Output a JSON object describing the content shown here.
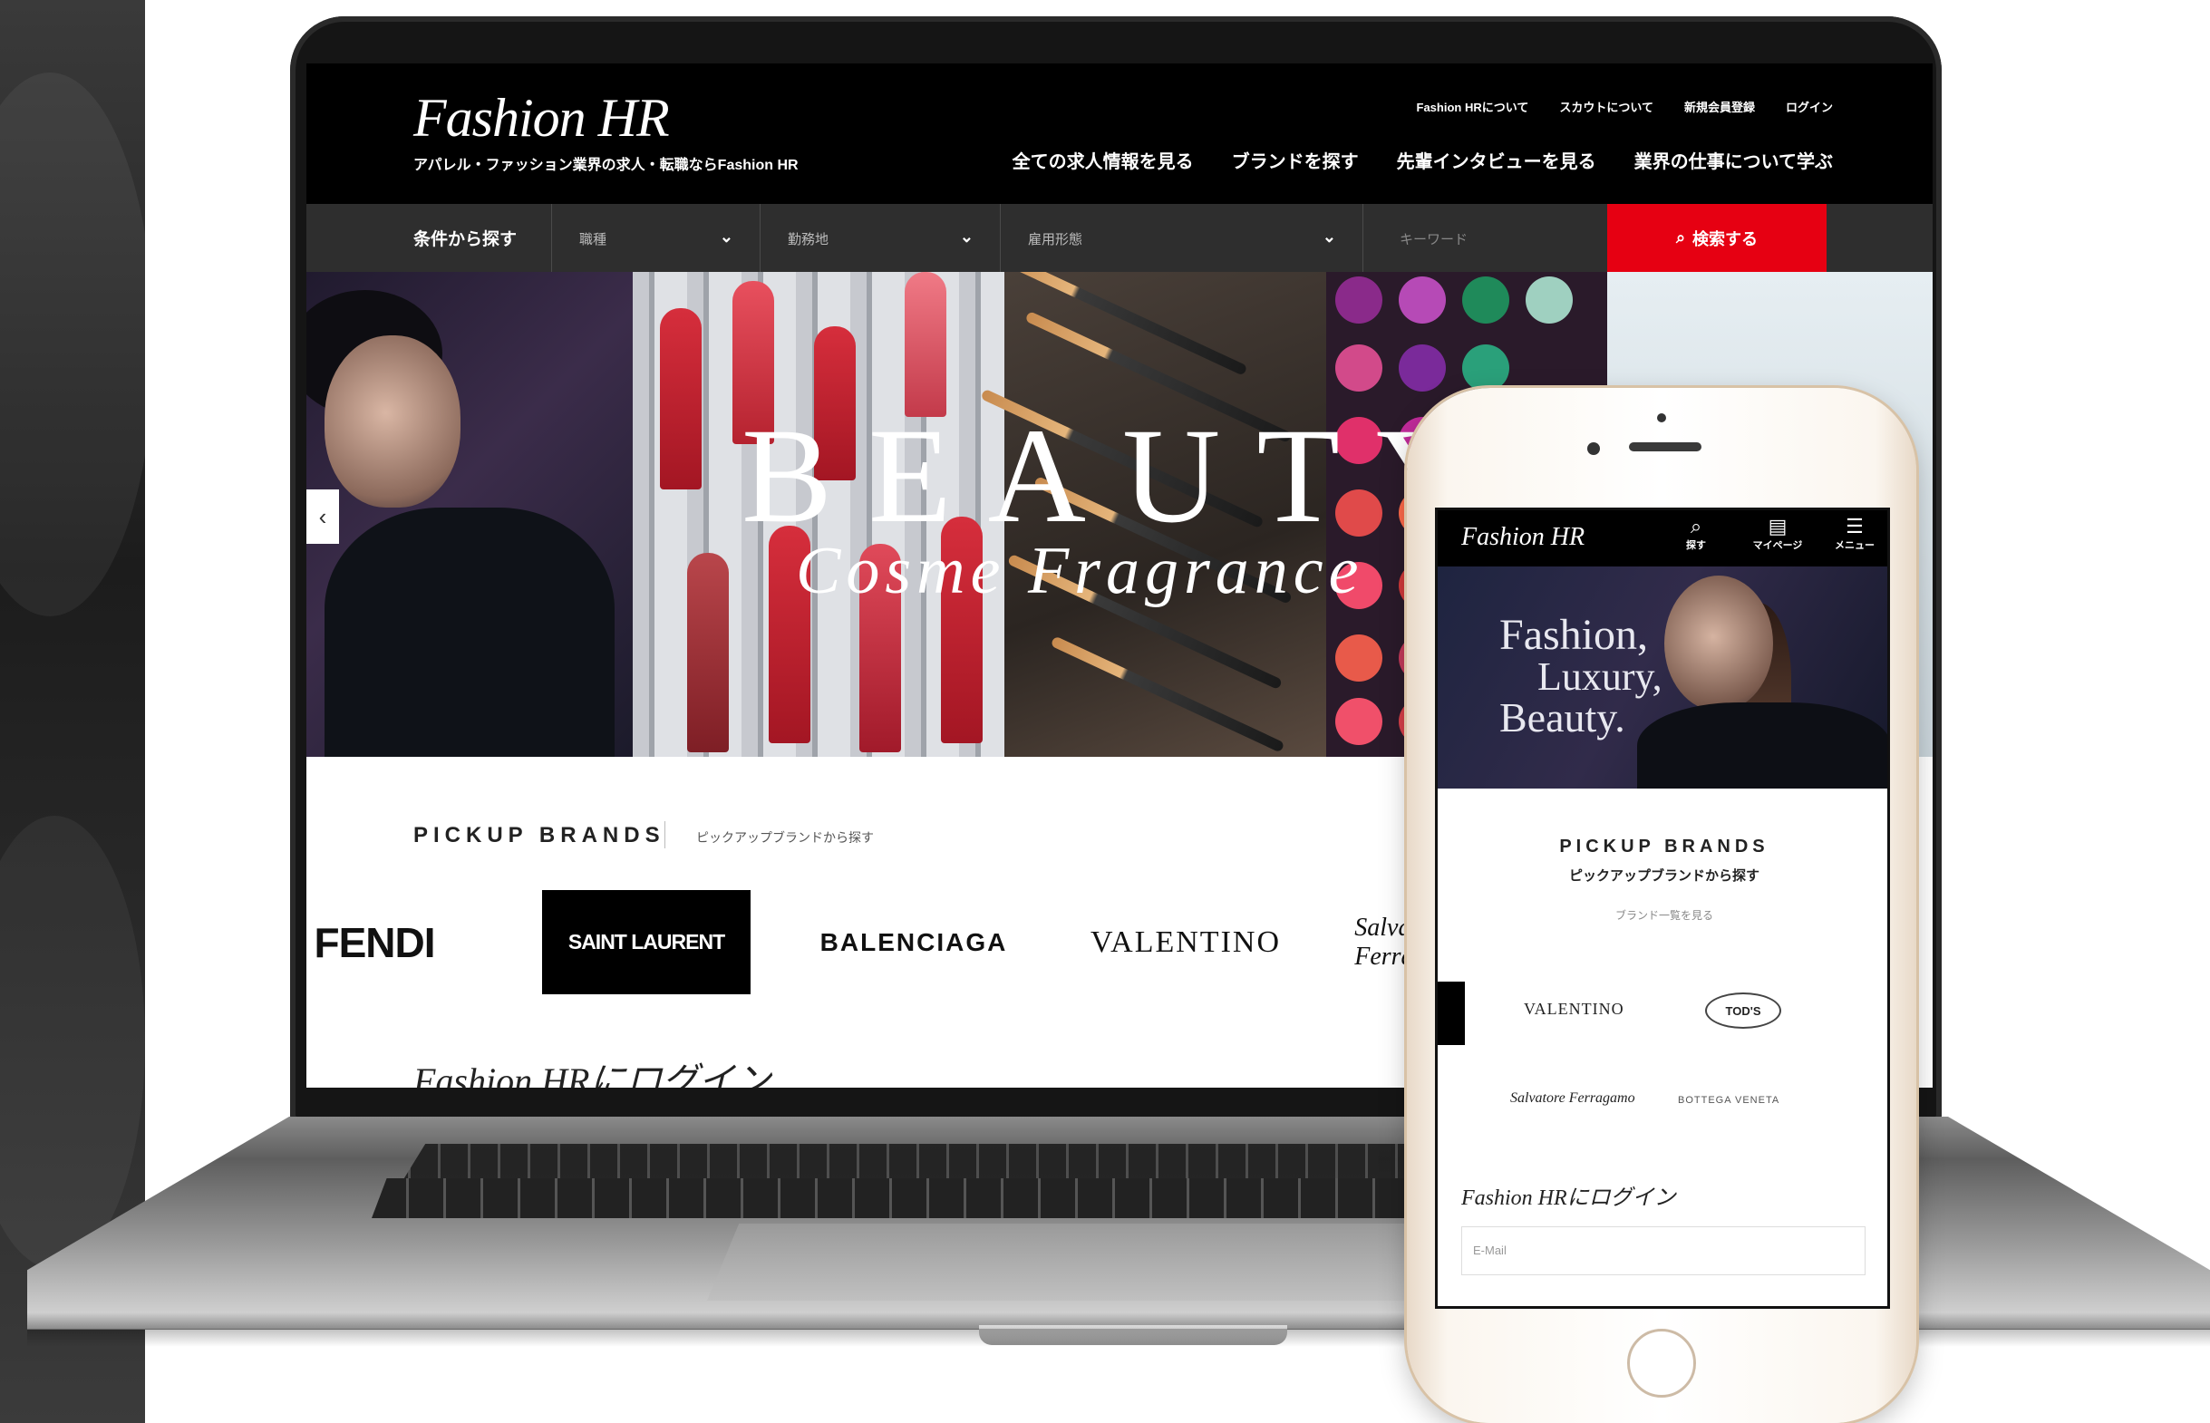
{
  "site": {
    "logo": "Fashion HR",
    "tagline": "アパレル・ファッション業界の求人・転職ならFashion HR",
    "util_nav": [
      "Fashion HRについて",
      "スカウトについて",
      "新規会員登録",
      "ログイン"
    ],
    "main_nav": [
      "全ての求人情報を見る",
      "ブランドを探す",
      "先輩インタビューを見る",
      "業界の仕事について学ぶ"
    ]
  },
  "search": {
    "label": "条件から探す",
    "selects": [
      "職種",
      "勤務地",
      "雇用形態"
    ],
    "keyword_placeholder": "キーワード",
    "button_label": "検索する"
  },
  "hero": {
    "title": "BEAUTY",
    "subtitle": "Cosme Fragrance",
    "prev_glyph": "‹"
  },
  "brands": {
    "title": "PICKUP BRANDS",
    "subtitle": "ピックアップブランドから探す",
    "items": [
      "FENDI",
      "SAINT LAURENT",
      "BALENCIAGA",
      "VALENTINO",
      "Salvatore Ferragamo"
    ],
    "login_title": "Fashion HRにログイン"
  },
  "phone": {
    "logo": "Fashion HR",
    "icons": [
      {
        "icon": "search-icon",
        "label": "探す"
      },
      {
        "icon": "mypage-icon",
        "label": "マイページ"
      },
      {
        "icon": "menu-icon",
        "label": "メニュー"
      }
    ],
    "hero_lines": [
      "Fashion,",
      "Luxury,",
      "Beauty."
    ],
    "pickup_title": "PICKUP BRANDS",
    "pickup_sub": "ピックアップブランドから探す",
    "more_link": "ブランド一覧を見る",
    "brands": [
      "VALENTINO",
      "TOD'S",
      "Salvatore Ferragamo",
      "BOTTEGA VENETA"
    ],
    "login_title": "Fashion HRにログイン",
    "email_placeholder": "E-Mail"
  }
}
